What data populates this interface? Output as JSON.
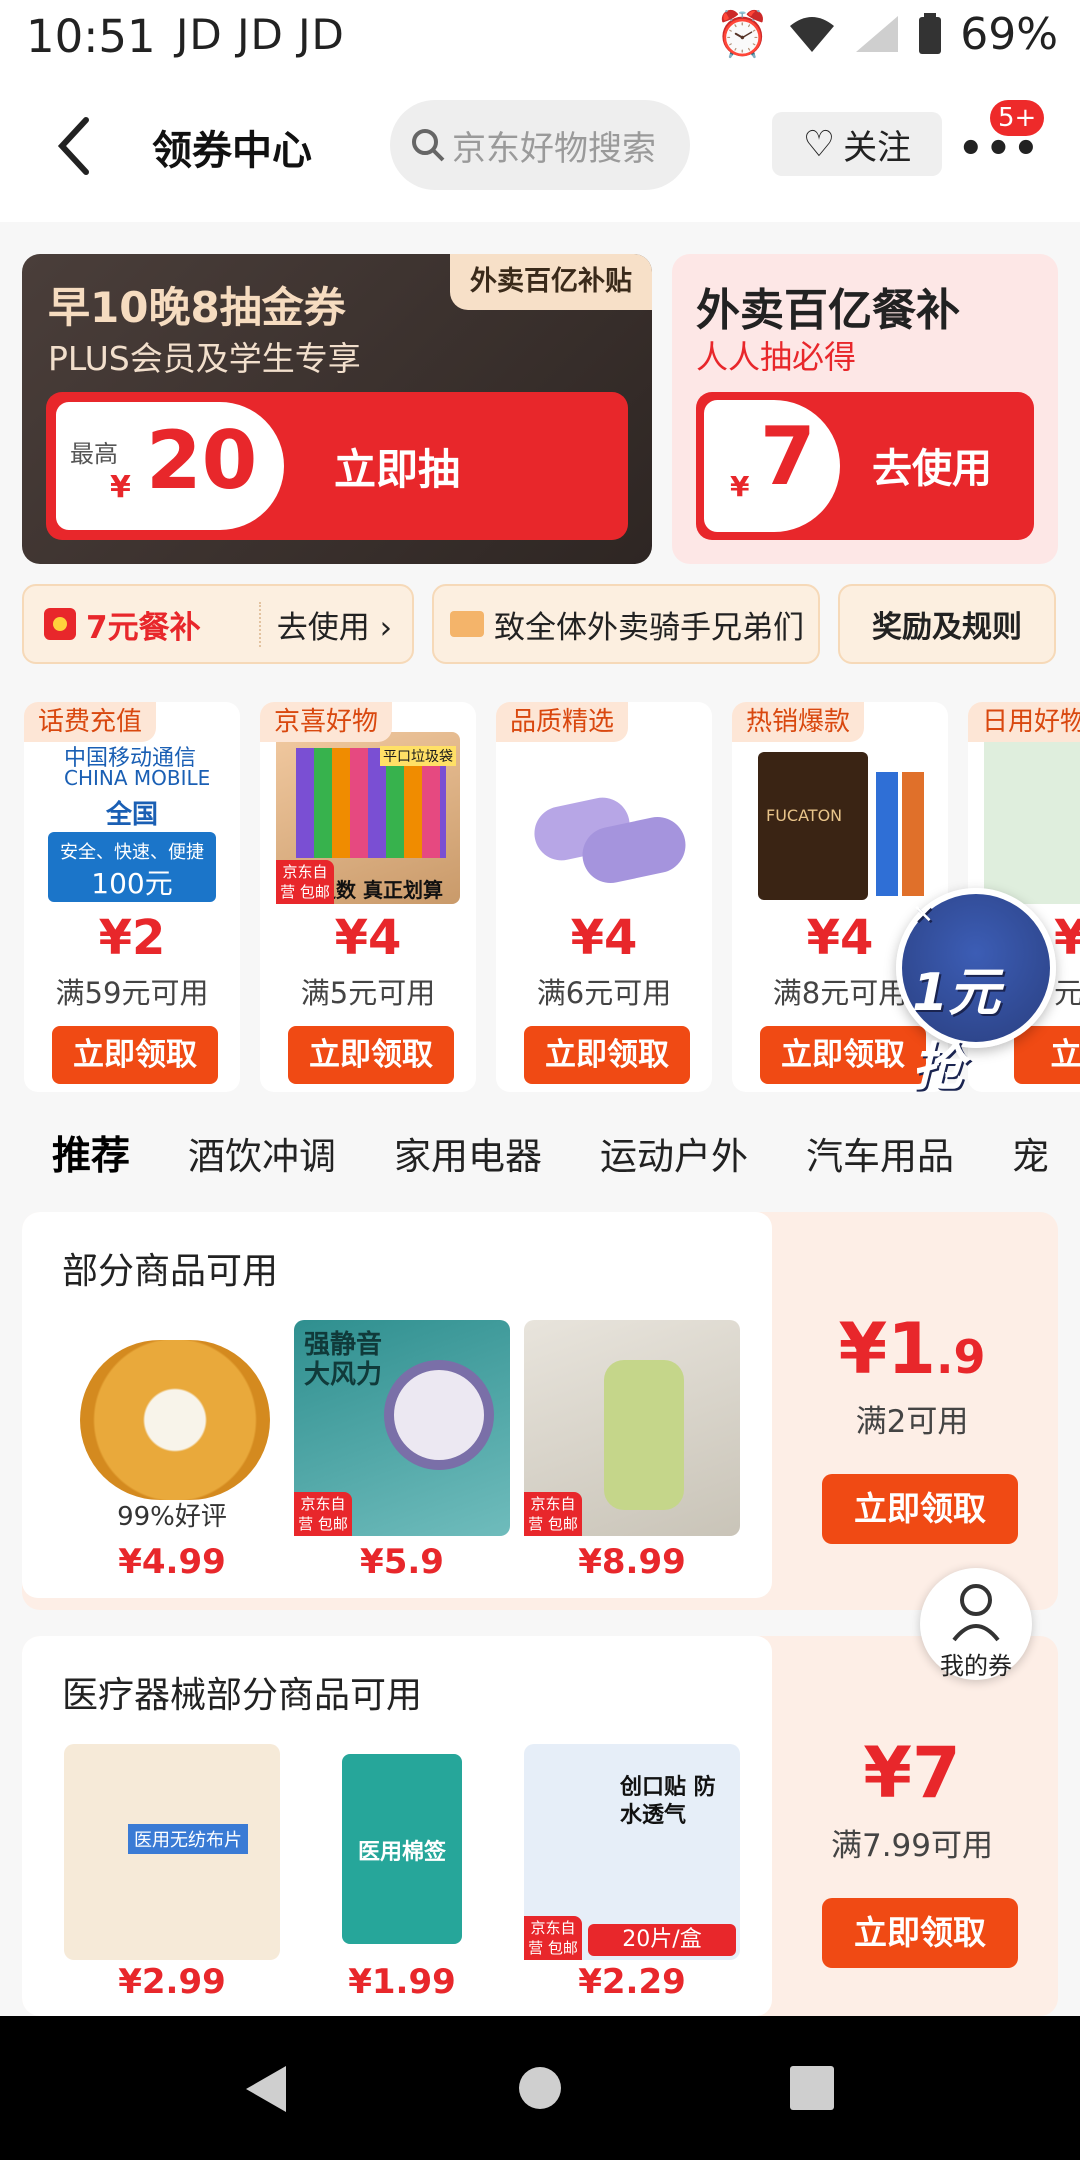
{
  "status_bar": {
    "time": "10:51",
    "carrier": "JD JD JD",
    "battery": "69%"
  },
  "header": {
    "title": "领券中心",
    "search_placeholder": "京东好物搜索",
    "follow_label": "关注",
    "more": "•••",
    "badge": "5+"
  },
  "banner_left": {
    "tag": "外卖百亿补贴",
    "title": "早10晚8抽金券",
    "subtitle": "PLUS会员及学生专享",
    "max_label": "最高",
    "currency": "¥",
    "amount": "20",
    "button": "立即抽"
  },
  "banner_right": {
    "title": "外卖百亿餐补",
    "subtitle": "人人抽必得",
    "currency": "¥",
    "amount": "7",
    "button": "去使用"
  },
  "chips": {
    "meal_label": "7元餐补",
    "meal_use": "去使用 ›",
    "rider_label": "致全体外卖骑手兄弟们",
    "rules_label": "奖励及规则"
  },
  "product_coupons": [
    {
      "label": "话费充值",
      "price": "¥2",
      "cond": "满59元可用",
      "button": "立即领取",
      "img_lines": [
        "中国移动通信",
        "CHINA MOBILE",
        "全国",
        "安全、快速、便捷",
        "100元"
      ]
    },
    {
      "label": "京喜好物",
      "price": "¥4",
      "cond": "满5元可用",
      "button": "立即领取",
      "img_lines": [
        "平口垃圾袋",
        "足数 真正划算"
      ]
    },
    {
      "label": "品质精选",
      "price": "¥4",
      "cond": "满6元可用",
      "button": "立即领取",
      "img_lines": []
    },
    {
      "label": "热销爆款",
      "price": "¥4",
      "cond": "满8元可用",
      "button": "立即领取",
      "img_lines": [
        "FUCATON"
      ]
    },
    {
      "label": "日用好物",
      "price": "¥",
      "cond": "元",
      "button": "立即领",
      "img_lines": []
    }
  ],
  "float_promo": "1元抢",
  "tabs": [
    "推荐",
    "酒饮冲调",
    "家用电器",
    "运动户外",
    "汽车用品",
    "宠"
  ],
  "sections": [
    {
      "title": "部分商品可用",
      "amount_int": "¥1",
      "amount_dec": ".9",
      "cond": "满2可用",
      "button": "立即领取",
      "products": [
        {
          "price": "¥4.99",
          "rating": "99%好评",
          "img_text": ""
        },
        {
          "price": "¥5.9",
          "img_text": "强静音 大风力"
        },
        {
          "price": "¥8.99",
          "img_text": ""
        }
      ]
    },
    {
      "title": "医疗器械部分商品可用",
      "amount_int": "¥7",
      "amount_dec": "",
      "cond": "满7.99可用",
      "button": "立即领取",
      "products": [
        {
          "price": "¥2.99",
          "img_text": "医用无纺布片"
        },
        {
          "price": "¥1.99",
          "img_text": "医用棉签"
        },
        {
          "price": "¥2.29",
          "img_text": "创口贴 防水透气",
          "sub_tag": "20片/盒"
        }
      ]
    }
  ],
  "jd_tag": "京东自营 包邮",
  "my_coupon": "我的券",
  "colors": {
    "accent": "#e8272b",
    "button": "#f04a14"
  }
}
